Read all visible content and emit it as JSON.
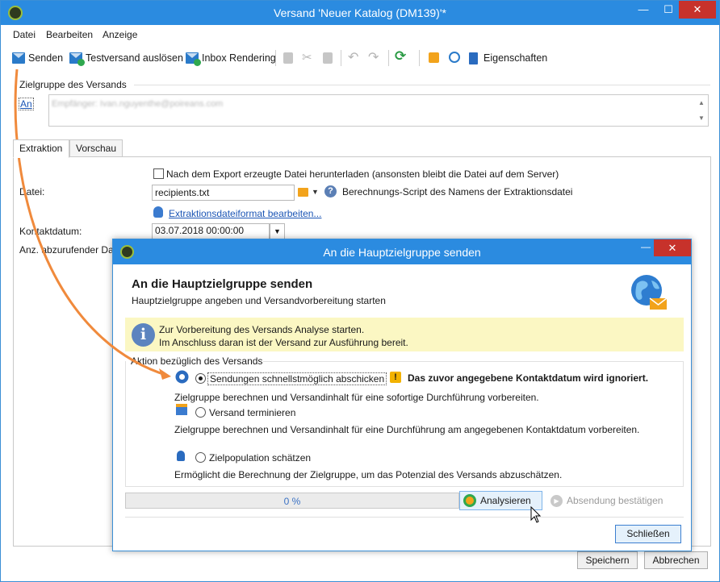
{
  "window": {
    "title": "Versand 'Neuer Katalog (DM139)'*",
    "minimize_glyph": "—",
    "maximize_glyph": "☐",
    "close_glyph": "✕"
  },
  "menu": {
    "items": [
      "Datei",
      "Bearbeiten",
      "Anzeige"
    ]
  },
  "toolbar": {
    "send_label": "Senden",
    "test_label": "Testversand auslösen",
    "inbox_label": "Inbox Rendering",
    "properties_label": "Eigenschaften"
  },
  "target": {
    "group_title": "Zielgruppe des Versands",
    "to_link": "An",
    "recipients_text": "Empfänger: Ivan.nguyenthe@poireans.com"
  },
  "tabs": {
    "extraction": "Extraktion",
    "preview": "Vorschau"
  },
  "extraction": {
    "download_checkbox_label": "Nach dem Export erzeugte Datei herunterladen (ansonsten bleibt die Datei auf dem Server)",
    "file_label": "Datei:",
    "file_value": "recipients.txt",
    "script_label": "Berechnungs-Script des Namens der Extraktionsdatei",
    "format_link": "Extraktionsdateiformat bearbeiten...",
    "contact_date_label": "Kontaktdatum:",
    "contact_date_value": "03.07.2018 00:00:00",
    "count_label": "Anz. abzurufender Dat"
  },
  "footer": {
    "save_label": "Speichern",
    "cancel_label": "Abbrechen"
  },
  "dialog": {
    "title": "An die Hauptzielgruppe senden",
    "heading": "An die Hauptzielgruppe senden",
    "subheading": "Hauptzielgruppe angeben und Versandvorbereitung starten",
    "info_line1": "Zur Vorbereitung des Versands Analyse starten.",
    "info_line2": "Im Anschluss daran ist der Versand zur Ausführung bereit.",
    "group_title": "Aktion bezüglich des Versands",
    "options": [
      {
        "label": "Sendungen schnellstmöglich abschicken",
        "desc": "Zielgruppe berechnen und Versandinhalt für eine sofortige Durchführung vorbereiten.",
        "selected": true
      },
      {
        "label": "Versand terminieren",
        "desc": "Zielgruppe berechnen und Versandinhalt für eine Durchführung am angegebenen Kontaktdatum vorbereiten.",
        "selected": false
      },
      {
        "label": "Zielpopulation schätzen",
        "desc": "Ermöglicht die Berechnung der Zielgruppe, um das Potenzial des Versands abzuschätzen.",
        "selected": false
      }
    ],
    "warning_text": "Das zuvor angegebene Kontaktdatum wird ignoriert.",
    "progress_value": 0,
    "progress_text": "0 %",
    "analyse_label": "Analysieren",
    "confirm_label": "Absendung bestätigen",
    "close_label": "Schließen"
  },
  "colors": {
    "titlebar": "#2b8be0",
    "close": "#c7322b",
    "link": "#1b55b5",
    "infobar": "#fbf7c3",
    "arrow": "#f08a3c"
  },
  "icons": [
    "app-logo-icon",
    "send-mail-icon",
    "test-send-icon",
    "inbox-rendering-icon",
    "copy-icon",
    "cut-icon",
    "paste-icon",
    "undo-icon",
    "redo-icon",
    "refresh-icon",
    "gift-icon",
    "target-icon",
    "properties-icon",
    "help-icon",
    "database-icon",
    "info-icon",
    "globe-mail-icon",
    "warning-icon",
    "calendar-icon",
    "person-gear-icon",
    "gear-icon",
    "play-icon"
  ]
}
